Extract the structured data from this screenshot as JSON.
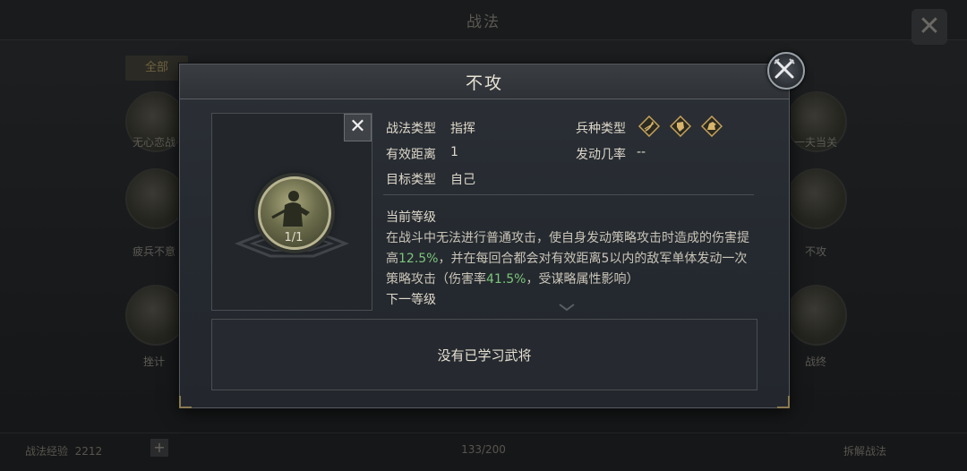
{
  "background": {
    "title": "战法",
    "close_symbol": "✕",
    "tab_label": "全部",
    "cards": [
      {
        "label": "无心恋战"
      },
      {
        "label": "疲兵不意"
      },
      {
        "label": "挫计"
      },
      {
        "label": "一夫当关"
      },
      {
        "label": "不攻"
      },
      {
        "label": "战终"
      }
    ],
    "bottom": {
      "left_label": "战法经验",
      "left_value": "2212",
      "plus": "+",
      "page_indicator": "133/200",
      "right_label": "拆解战法"
    }
  },
  "dialog": {
    "title": "不攻",
    "close_symbol": "✕",
    "portrait": {
      "close_symbol": "✕",
      "level": "1/1"
    },
    "fields": {
      "tactic_type_label": "战法类型",
      "tactic_type_value": "指挥",
      "range_label": "有效距离",
      "range_value": "1",
      "target_label": "目标类型",
      "target_value": "自己",
      "arms_label": "兵种类型",
      "trigger_label": "发动几率",
      "trigger_value": "--"
    },
    "arms_icons": [
      "bow-icon",
      "shield-icon",
      "cavalry-icon"
    ],
    "current_level_label": "当前等级",
    "description": {
      "p1": "在战斗中无法进行普通攻击，使自身发动策略攻击时造成的伤害提高",
      "v1": "12.5%",
      "p2": "，并在每回合都会对有效距离5以内的敌军单体发动一次策略攻击（伤害率",
      "v2": "41.5%",
      "p3": "，受谋略属性影响）"
    },
    "next_level_label": "下一等级",
    "empty_text": "没有已学习武将"
  },
  "colors": {
    "highlight": "#7cc67a",
    "gold_icon": "#c9a35a"
  }
}
